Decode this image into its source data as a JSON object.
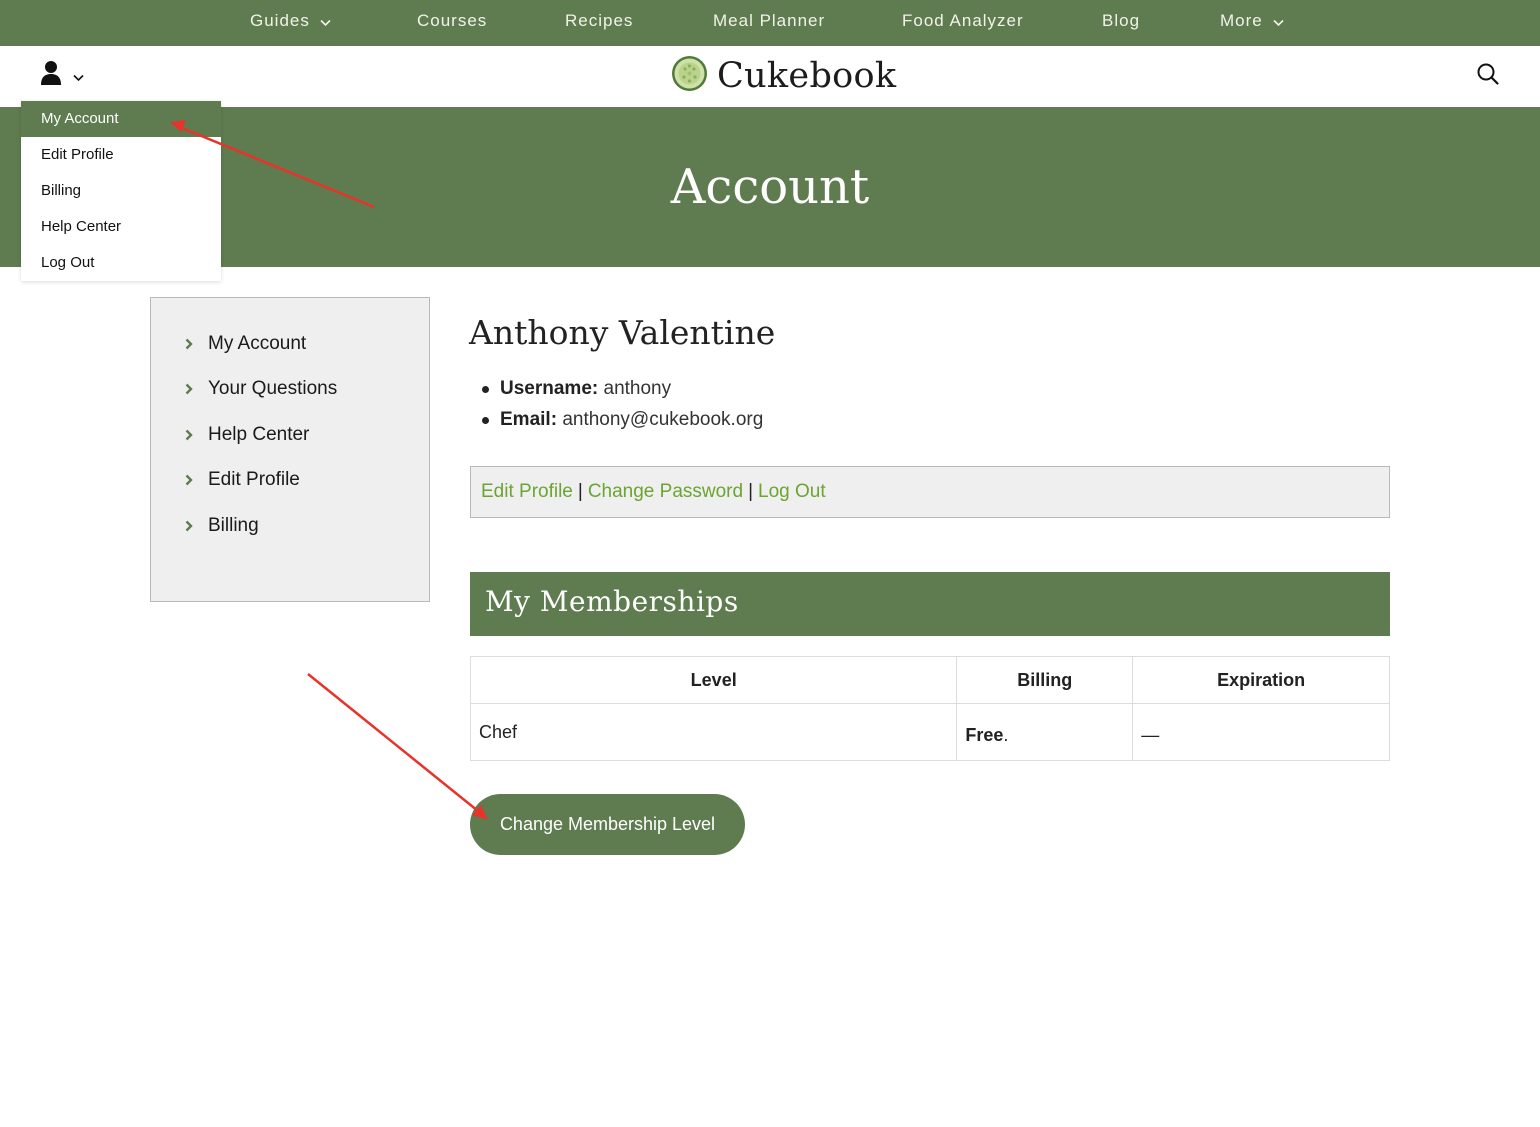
{
  "top_nav": {
    "items": [
      {
        "label": "Guides",
        "has_dropdown": true
      },
      {
        "label": "Courses",
        "has_dropdown": false
      },
      {
        "label": "Recipes",
        "has_dropdown": false
      },
      {
        "label": "Meal Planner",
        "has_dropdown": false
      },
      {
        "label": "Food Analyzer",
        "has_dropdown": false
      },
      {
        "label": "Blog",
        "has_dropdown": false
      },
      {
        "label": "More",
        "has_dropdown": true
      }
    ]
  },
  "header": {
    "brand": "Cukebook",
    "user_icon": "user-icon",
    "search_icon": "search-icon"
  },
  "banner": {
    "title": "Account"
  },
  "user_menu": {
    "items": [
      {
        "label": "My Account",
        "active": true
      },
      {
        "label": "Edit Profile",
        "active": false
      },
      {
        "label": "Billing",
        "active": false
      },
      {
        "label": "Help Center",
        "active": false
      },
      {
        "label": "Log Out",
        "active": false
      }
    ]
  },
  "sidebar": {
    "items": [
      {
        "label": "My Account"
      },
      {
        "label": "Your Questions"
      },
      {
        "label": "Help Center"
      },
      {
        "label": "Edit Profile"
      },
      {
        "label": "Billing"
      }
    ]
  },
  "profile": {
    "name": "Anthony Valentine",
    "username_label": "Username:",
    "username": "anthony",
    "email_label": "Email:",
    "email": "anthony@cukebook.org"
  },
  "actions": {
    "edit_profile": "Edit Profile",
    "change_password": "Change Password",
    "log_out": "Log Out",
    "separator": "|"
  },
  "memberships": {
    "title": "My Memberships",
    "columns": [
      "Level",
      "Billing",
      "Expiration"
    ],
    "rows": [
      {
        "level": "Chef",
        "billing": "Free",
        "billing_suffix": ".",
        "expiration": "—"
      }
    ],
    "change_button": "Change Membership Level"
  },
  "colors": {
    "brand_green": "#5e7c4f",
    "link_green": "#6aa531",
    "panel_gray": "#efefef",
    "annotation_red": "#e8332a"
  }
}
